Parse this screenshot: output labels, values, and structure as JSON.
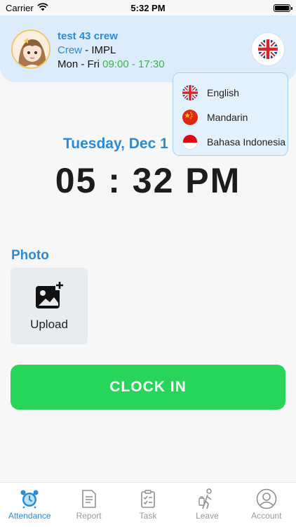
{
  "status_bar": {
    "carrier": "Carrier",
    "time": "5:32 PM"
  },
  "user": {
    "name": "test 43 crew",
    "role": "Crew",
    "separator": " - ",
    "company": "IMPL",
    "schedule_days": "Mon - Fri",
    "schedule_time": "09:00 - 17:30"
  },
  "language_menu": {
    "selected": "English",
    "options": [
      {
        "label": "English",
        "flag": "uk-flag-icon"
      },
      {
        "label": "Mandarin",
        "flag": "china-flag-icon"
      },
      {
        "label": "Bahasa Indonesia",
        "flag": "indonesia-flag-icon"
      }
    ]
  },
  "date": "Tuesday, Dec 1",
  "clock": "05 : 32 PM",
  "photo": {
    "title": "Photo",
    "upload_label": "Upload"
  },
  "clock_in_label": "CLOCK IN",
  "tabs": [
    {
      "label": "Attendance",
      "icon": "alarm-clock-icon",
      "active": true
    },
    {
      "label": "Report",
      "icon": "report-icon",
      "active": false
    },
    {
      "label": "Task",
      "icon": "task-icon",
      "active": false
    },
    {
      "label": "Leave",
      "icon": "leave-icon",
      "active": false
    },
    {
      "label": "Account",
      "icon": "account-icon",
      "active": false
    }
  ],
  "colors": {
    "accent": "#2a8bd6",
    "clock_in": "#27d55a",
    "schedule": "#3cb44b",
    "header_bg": "#dcecfa"
  }
}
